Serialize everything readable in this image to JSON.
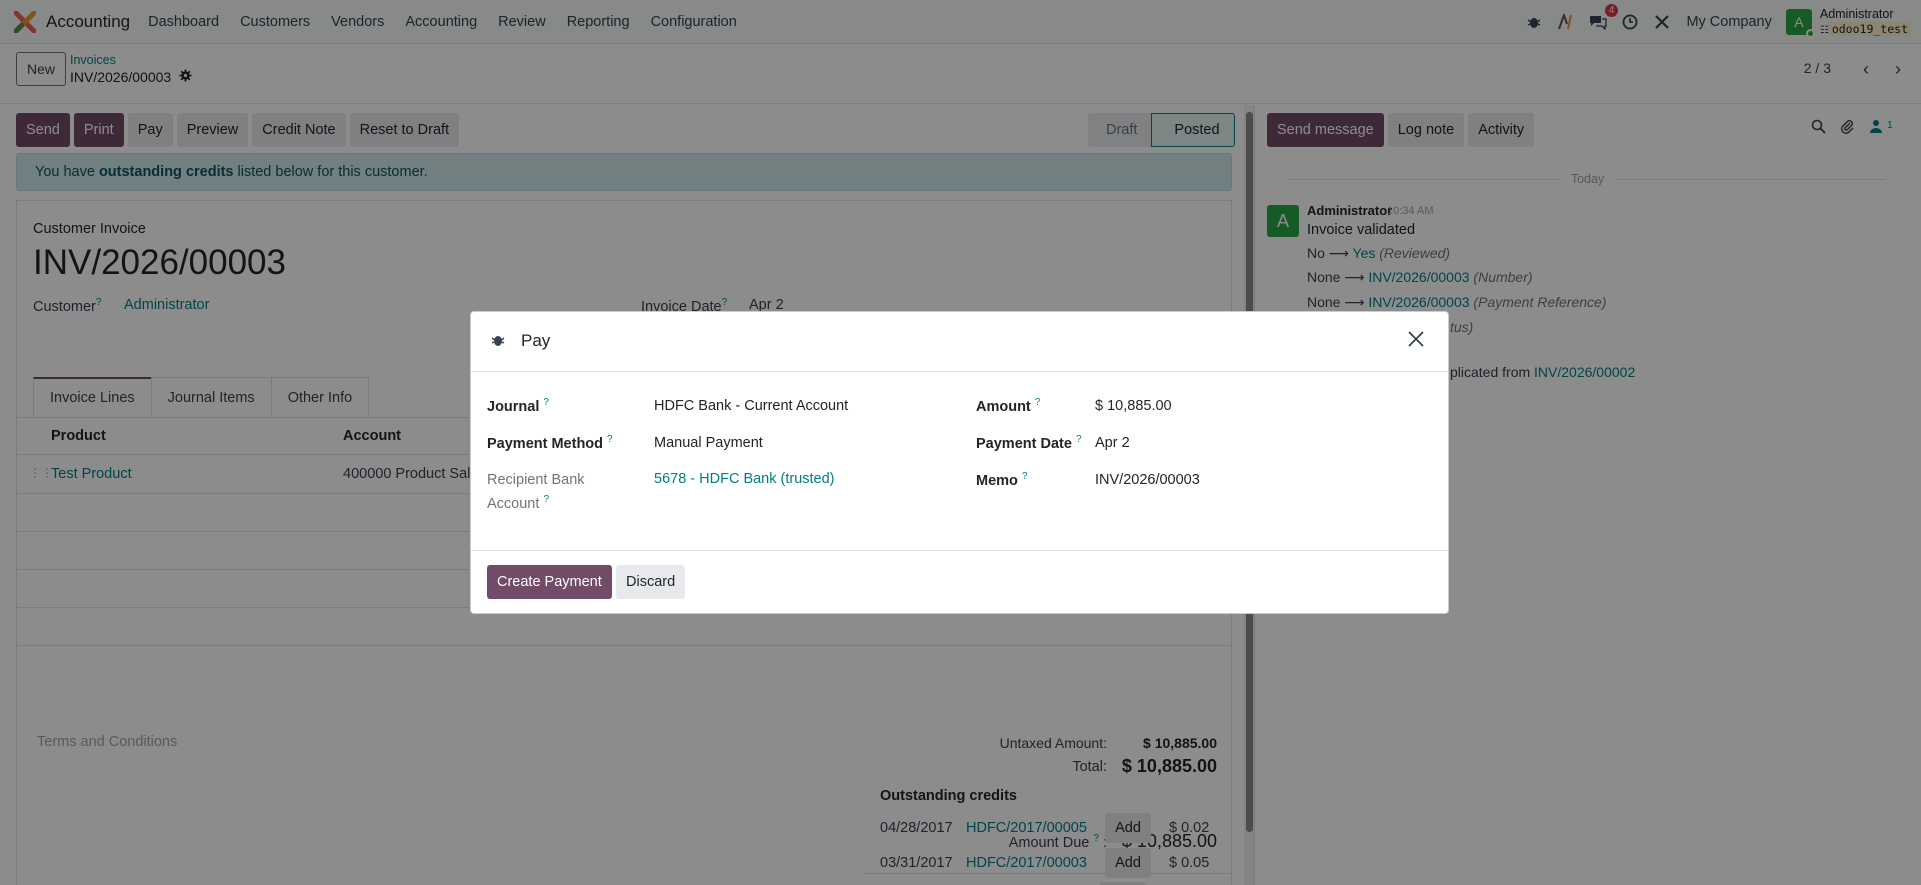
{
  "navbar": {
    "app_name": "Accounting",
    "menu": [
      "Dashboard",
      "Customers",
      "Vendors",
      "Accounting",
      "Review",
      "Reporting",
      "Configuration"
    ],
    "messages_badge": "4",
    "company": "My Company",
    "avatar_letter": "A",
    "user_name": "Administrator",
    "db_name": "odoo19_test"
  },
  "control": {
    "new_label": "New",
    "breadcrumb_parent": "Invoices",
    "breadcrumb_current": "INV/2026/00003",
    "pager": "2 / 3"
  },
  "actions": {
    "send": "Send",
    "print": "Print",
    "pay": "Pay",
    "preview": "Preview",
    "credit_note": "Credit Note",
    "reset": "Reset to Draft"
  },
  "status": {
    "draft": "Draft",
    "posted": "Posted"
  },
  "alert": {
    "pre": "You have",
    "bold": "outstanding credits",
    "post": "listed below for this customer."
  },
  "invoice": {
    "type": "Customer Invoice",
    "name": "INV/2026/00003",
    "customer_label": "Customer",
    "customer": "Administrator",
    "date_label": "Invoice Date",
    "date": "Apr 2",
    "tabs": [
      "Invoice Lines",
      "Journal Items",
      "Other Info"
    ],
    "columns": {
      "product": "Product",
      "account": "Account"
    },
    "line": {
      "product": "Test Product",
      "account": "400000 Product Sale"
    },
    "terms": "Terms and Conditions",
    "untaxed_label": "Untaxed Amount:",
    "untaxed": "$ 10,885.00",
    "total_label": "Total:",
    "total": "$ 10,885.00",
    "due_label": "Amount Due",
    "due_colon": ":",
    "due": "$ 10,885.00",
    "credits_title": "Outstanding credits",
    "credits": [
      {
        "date": "04/28/2017",
        "ref": "HDFC/2017/00005",
        "add": "Add",
        "amount": "$ 0.02"
      },
      {
        "date": "03/31/2017",
        "ref": "HDFC/2017/00003",
        "add": "Add",
        "amount": "$ 0.05"
      }
    ]
  },
  "chatter": {
    "send_message": "Send message",
    "log_note": "Log note",
    "activity": "Activity",
    "followers": "1",
    "today": "Today",
    "avatar_letter": "A",
    "author": "Administrator",
    "time": "10:34 AM",
    "body": "Invoice validated",
    "tracking": [
      {
        "old": "No",
        "new": "Yes",
        "field": "(Reviewed)"
      },
      {
        "old": "None",
        "new": "INV/2026/00003",
        "field": "(Number)"
      },
      {
        "old": "None",
        "new": "INV/2026/00003",
        "field": "(Payment Reference)"
      }
    ],
    "partial_status": "tus)",
    "partial_dup": "plicated from",
    "dup_ref": "INV/2026/00002"
  },
  "modal": {
    "title": "Pay",
    "journal_label": "Journal",
    "journal": "HDFC Bank - Current Account",
    "method_label": "Payment Method",
    "method": "Manual Payment",
    "recipient_label_1": "Recipient Bank",
    "recipient_label_2": "Account",
    "recipient": "5678 - HDFC Bank (trusted)",
    "amount_label": "Amount",
    "amount": "$ 10,885.00",
    "date_label": "Payment Date",
    "date": "Apr 2",
    "memo_label": "Memo",
    "memo": "INV/2026/00003",
    "create_btn": "Create Payment",
    "discard_btn": "Discard",
    "help_mark": "?"
  }
}
